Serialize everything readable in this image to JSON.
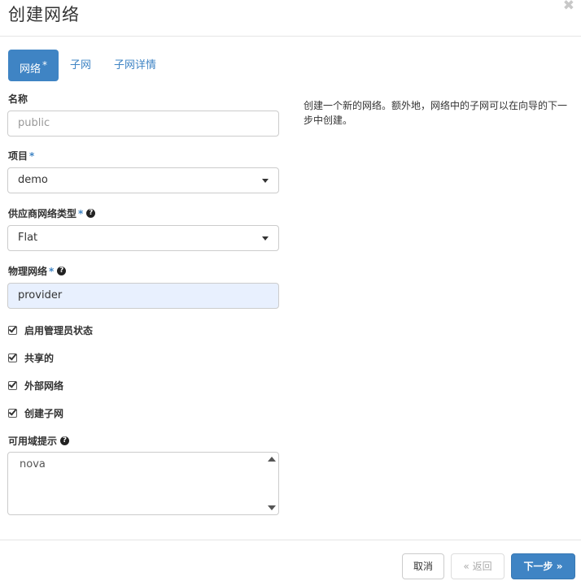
{
  "dialog": {
    "title": "创建网络",
    "close_glyph": "✖"
  },
  "tabs": [
    {
      "label": "网络",
      "active": true,
      "required": "*"
    },
    {
      "label": "子网",
      "active": false
    },
    {
      "label": "子网详情",
      "active": false
    }
  ],
  "form": {
    "name": {
      "label": "名称",
      "placeholder": "public"
    },
    "project": {
      "label": "项目",
      "required": "*",
      "value": "demo"
    },
    "provider_type": {
      "label": "供应商网络类型",
      "required": "*",
      "value": "Flat"
    },
    "physical_network": {
      "label": "物理网络",
      "required": "*",
      "value": "provider"
    },
    "checkboxes": [
      {
        "label": "启用管理员状态",
        "checked": true
      },
      {
        "label": "共享的",
        "checked": true
      },
      {
        "label": "外部网络",
        "checked": true
      },
      {
        "label": "创建子网",
        "checked": true
      }
    ],
    "az_hints": {
      "label": "可用域提示",
      "option": "nova"
    }
  },
  "description": "创建一个新的网络。额外地，网络中的子网可以在向导的下一步中创建。",
  "footer": {
    "cancel": "取消",
    "back": "« 返回",
    "next": "下一步 »"
  },
  "colors": {
    "accent": "#3f84c4",
    "autofill": "#e8f0fe"
  },
  "icons": {
    "help": "question-circle-icon",
    "check": "checkbox-checked-icon",
    "close": "close-icon"
  }
}
